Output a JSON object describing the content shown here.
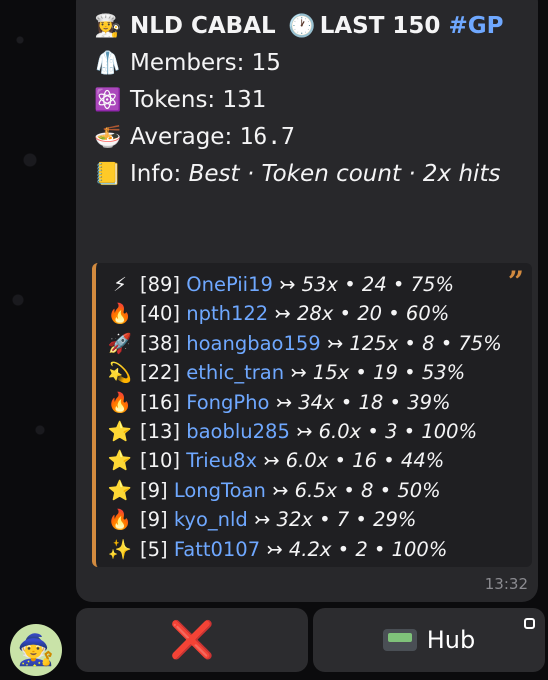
{
  "header": {
    "title_icon": "👩‍🍳",
    "title": "NLD CABAL",
    "clock_icon": "🕐",
    "period": "LAST 150",
    "hashtag": "#GP"
  },
  "stats": {
    "members_icon": "🥼",
    "members": "Members: 15",
    "tokens_icon": "⚛️",
    "tokens_label": "Tokens: 131",
    "average_icon": "🍜",
    "average_label": "Average: ",
    "average_value": "16.7",
    "info_icon": "📒",
    "info_label": "Info: ",
    "info_value": "Best · Token count · 2x hits"
  },
  "rows": [
    {
      "icon": "⚡",
      "rank": "[89]",
      "user": "OnePii19",
      "stats": "↣ 53x • 24 • 75%"
    },
    {
      "icon": "🔥",
      "rank": "[40]",
      "user": "npth122",
      "stats": "↣ 28x • 20 • 60%"
    },
    {
      "icon": "🚀",
      "rank": "[38]",
      "user": "hoangbao159",
      "stats": "↣ 125x • 8 • 75%"
    },
    {
      "icon": "💫",
      "rank": "[22]",
      "user": "ethic_tran",
      "stats": "↣ 15x • 19 • 53%"
    },
    {
      "icon": "🔥",
      "rank": "[16]",
      "user": "FongPho",
      "stats": "↣ 34x • 18 • 39%"
    },
    {
      "icon": "⭐",
      "rank": "[13]",
      "user": "baoblu285",
      "stats": "↣ 6.0x • 3 • 100%"
    },
    {
      "icon": "⭐",
      "rank": "[10]",
      "user": "Trieu8x",
      "stats": "↣ 6.0x • 16 • 44%"
    },
    {
      "icon": "⭐",
      "rank": "[9]",
      "user": "LongToan",
      "stats": "↣ 6.5x • 8 • 50%"
    },
    {
      "icon": "🔥",
      "rank": "[9]",
      "user": "kyo_nld",
      "stats": "↣ 32x • 7 • 29%"
    },
    {
      "icon": "✨",
      "rank": "[5]",
      "user": "Fatt0107",
      "stats": "↣ 4.2x • 2 • 100%"
    }
  ],
  "quote_mark": "”",
  "timestamp": "13:32",
  "buttons": {
    "close_label": "❌",
    "hub_label": "Hub",
    "hub_icon": "pager-icon"
  },
  "avatar_icon": "🧙"
}
